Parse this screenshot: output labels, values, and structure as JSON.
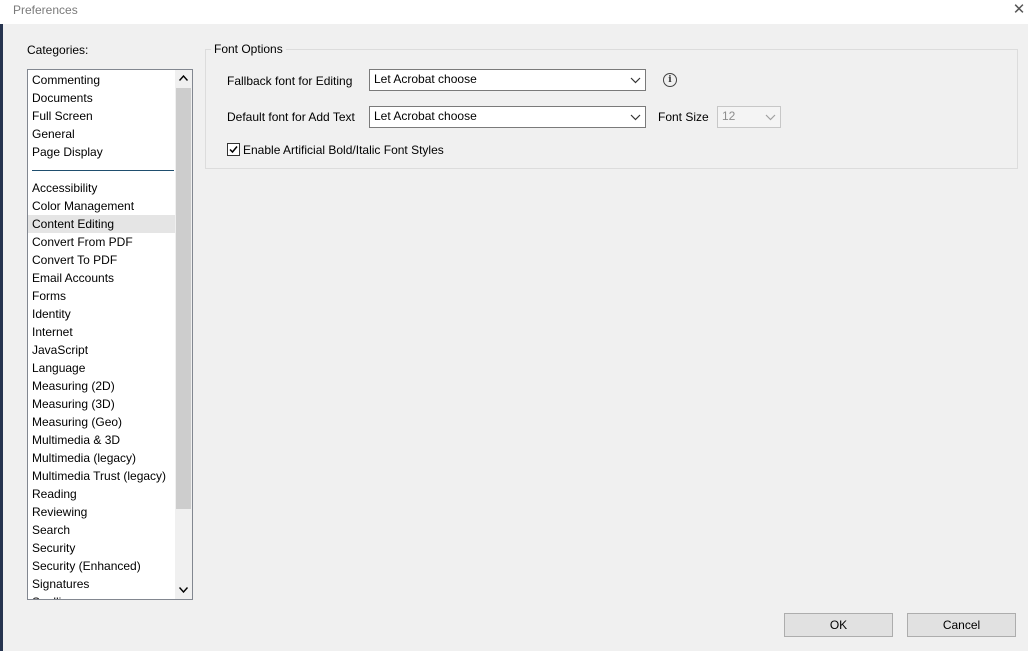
{
  "window": {
    "title": "Preferences",
    "close_glyph": "✕"
  },
  "categories": {
    "label": "Categories:",
    "group1": [
      "Commenting",
      "Documents",
      "Full Screen",
      "General",
      "Page Display"
    ],
    "group2": [
      "Accessibility",
      "Color Management",
      "Content Editing",
      "Convert From PDF",
      "Convert To PDF",
      "Email Accounts",
      "Forms",
      "Identity",
      "Internet",
      "JavaScript",
      "Language",
      "Measuring (2D)",
      "Measuring (3D)",
      "Measuring (Geo)",
      "Multimedia & 3D",
      "Multimedia (legacy)",
      "Multimedia Trust (legacy)",
      "Reading",
      "Reviewing",
      "Search",
      "Security",
      "Security (Enhanced)",
      "Signatures",
      "Spelling"
    ],
    "selected": "Content Editing"
  },
  "font_options": {
    "title": "Font Options",
    "fallback_label": "Fallback font for Editing",
    "fallback_value": "Let Acrobat choose",
    "default_label": "Default font for Add Text",
    "default_value": "Let Acrobat choose",
    "font_size_label": "Font Size",
    "font_size_value": "12",
    "artificial_label": "Enable Artificial Bold/Italic Font Styles",
    "artificial_checked": true
  },
  "buttons": {
    "ok": "OK",
    "cancel": "Cancel"
  },
  "icons": {
    "info": "info-icon",
    "chevron": "chevron-down-icon",
    "close": "close-icon"
  },
  "colors": {
    "dialog_bg": "#f0f0f0",
    "separator": "#1f4e6e",
    "selection": "#e5e5e5"
  }
}
